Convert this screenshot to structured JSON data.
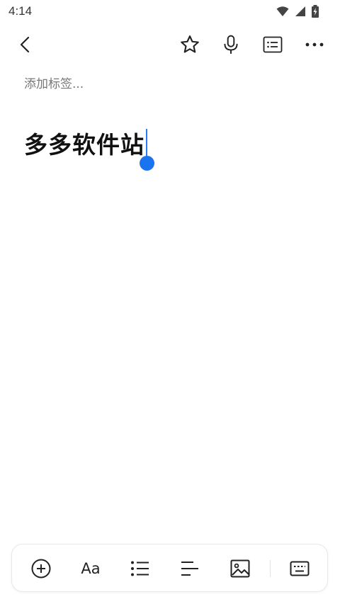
{
  "status_bar": {
    "time": "4:14",
    "icons": [
      "wifi-icon",
      "signal-icon",
      "battery-charging-icon"
    ]
  },
  "toolbar": {
    "back_icon": "chevron-left-icon",
    "favorite_icon": "star-icon",
    "voice_icon": "microphone-icon",
    "checklist_icon": "list-card-icon",
    "more_icon": "more-horizontal-icon"
  },
  "editor": {
    "tag_placeholder": "添加标签...",
    "title": "多多软件站",
    "cursor_color": "#1a73f0"
  },
  "bottom_bar": {
    "add_icon": "plus-circle-icon",
    "text_style_label": "Aa",
    "bullet_list_icon": "bullet-list-icon",
    "align_icon": "align-left-icon",
    "image_icon": "image-icon",
    "keyboard_icon": "keyboard-icon"
  }
}
